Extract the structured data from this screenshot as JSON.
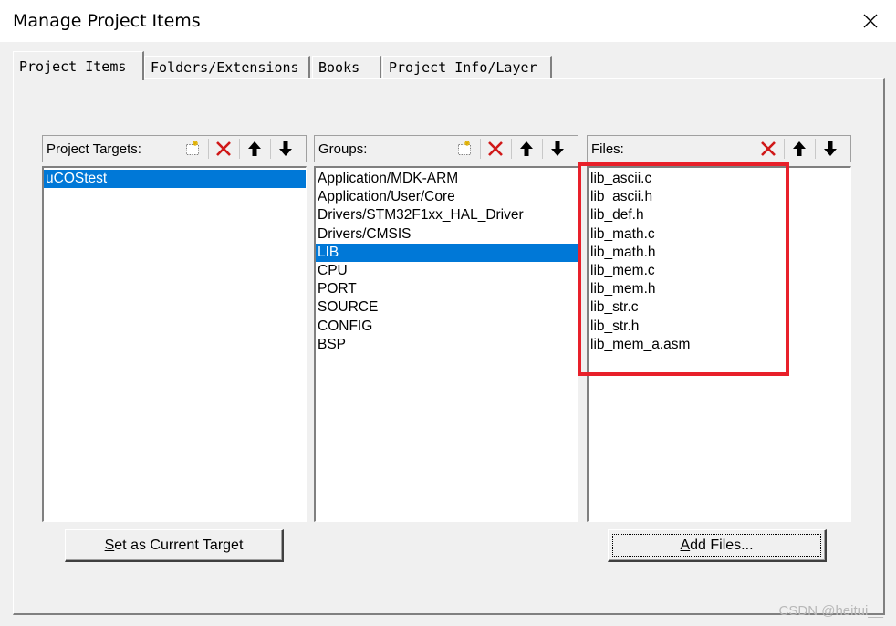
{
  "window": {
    "title": "Manage Project Items"
  },
  "tabs": [
    {
      "label": "Project Items",
      "active": true
    },
    {
      "label": "Folders/Extensions",
      "active": false
    },
    {
      "label": "Books",
      "active": false
    },
    {
      "label": "Project Info/Layer",
      "active": false
    }
  ],
  "project_targets": {
    "label": "Project Targets:",
    "items": [
      "uCOStest"
    ],
    "selected_index": 0,
    "button_label": "Set as Current Target",
    "button_mnemonic": "S"
  },
  "groups": {
    "label": "Groups:",
    "items": [
      "Application/MDK-ARM",
      "Application/User/Core",
      "Drivers/STM32F1xx_HAL_Driver",
      "Drivers/CMSIS",
      "LIB",
      "CPU",
      "PORT",
      "SOURCE",
      "CONFIG",
      "BSP"
    ],
    "selected_index": 4
  },
  "files": {
    "label": "Files:",
    "items": [
      "lib_ascii.c",
      "lib_ascii.h",
      "lib_def.h",
      "lib_math.c",
      "lib_math.h",
      "lib_mem.c",
      "lib_mem.h",
      "lib_str.c",
      "lib_str.h",
      "lib_mem_a.asm"
    ],
    "button_label": "Add Files...",
    "button_mnemonic": "A"
  },
  "watermark": "CSDN @heitui__",
  "colors": {
    "selection": "#0078d7",
    "highlight": "#e8202a"
  }
}
